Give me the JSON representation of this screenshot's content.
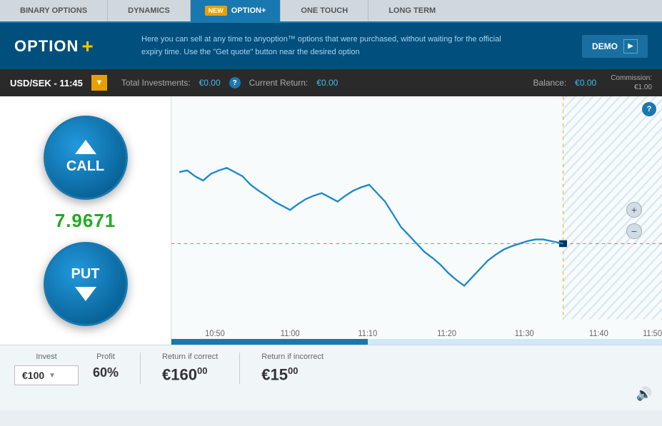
{
  "nav": {
    "items": [
      {
        "label": "BINARY OPTIONS",
        "active": false
      },
      {
        "label": "DYNAMICS",
        "active": false
      },
      {
        "label": "OPTION+",
        "active": true,
        "badge": "NEW"
      },
      {
        "label": "ONE TOUCH",
        "active": false
      },
      {
        "label": "LONG TERM",
        "active": false
      }
    ]
  },
  "header": {
    "logo_text": "OPTION",
    "logo_plus": "+",
    "description_line1": "Here you can sell at any time to anyoption™ options that were purchased, without waiting for the official",
    "description_line2": "expiry time. Use the \"Get quote\" button near the desired option",
    "demo_label": "DEMO"
  },
  "instrument_bar": {
    "name": "USD/SEK - 11:45",
    "total_investments_label": "Total Investments:",
    "total_investments_value": "€0.00",
    "current_return_label": "Current Return:",
    "current_return_value": "€0.00",
    "balance_label": "Balance:",
    "balance_value": "€0.00",
    "commission_label": "Commission:",
    "commission_value": "€1.00"
  },
  "trading": {
    "call_label": "CALL",
    "put_label": "PUT",
    "price": "7.9671"
  },
  "chart": {
    "times": [
      "10:50",
      "11:00",
      "11:10",
      "11:20",
      "11:30",
      "11:40",
      "11:50"
    ],
    "help_icon": "?"
  },
  "bottom": {
    "invest_label": "Invest",
    "invest_value": "€100",
    "profit_label": "Profit",
    "profit_value": "60%",
    "return_correct_label": "Return if correct",
    "return_correct_value": "€160",
    "return_correct_cents": "00",
    "return_incorrect_label": "Return if incorrect",
    "return_incorrect_value": "€15",
    "return_incorrect_cents": "00"
  }
}
